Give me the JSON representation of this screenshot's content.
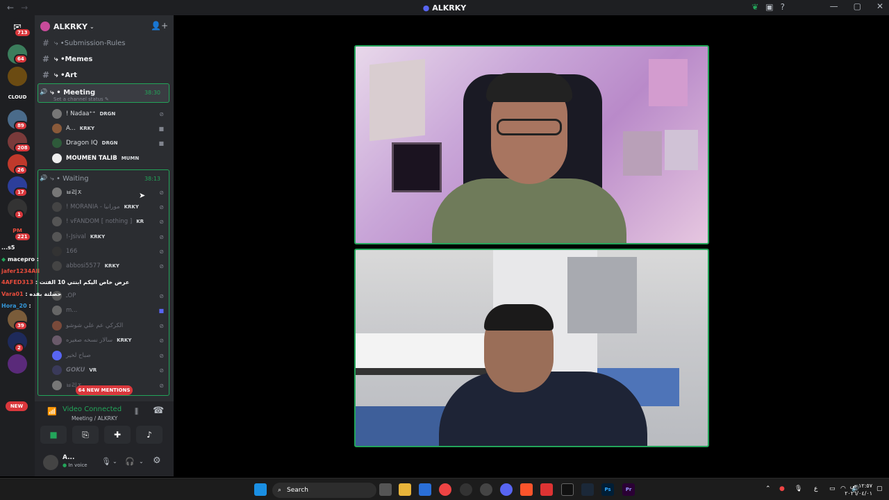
{
  "window": {
    "title": "ALKRKY",
    "back": "←",
    "forward": "→"
  },
  "guilds": {
    "home_badge": "713",
    "badges": [
      "64",
      "89",
      "208",
      "26",
      "17",
      "1",
      "221",
      "39",
      "2"
    ],
    "icon_labels": [
      "CLOUD",
      "PM",
      "NEW"
    ],
    "new_label": "NEW"
  },
  "server": {
    "name": "ALKRKY"
  },
  "channels": [
    {
      "name": "Submission-Rules"
    },
    {
      "name": "Memes"
    },
    {
      "name": "Art"
    }
  ],
  "meeting": {
    "name": "Meeting",
    "timer": "38:30",
    "status_hint": "Set a channel status",
    "users": [
      {
        "name": "! Nadaa⁺⁺",
        "tag": "DRGN"
      },
      {
        "name": "A...",
        "tag": "KRKY"
      },
      {
        "name": "Dragon IQ",
        "tag": "DRGN"
      },
      {
        "name": "MOUMEN TALIB",
        "tag": "MUMN"
      }
    ]
  },
  "waiting": {
    "name": "Waiting",
    "timer": "38:13",
    "users": [
      {
        "name": "ㅂ리ㅈ",
        "tag": ""
      },
      {
        "name": "! MORANIA - مورانيا",
        "tag": "KRKY"
      },
      {
        "name": "! vFANDOM [ nothing ]",
        "tag": "KR"
      },
      {
        "name": "!-Jsival",
        "tag": "KRKY"
      },
      {
        "name": "166",
        "tag": ""
      },
      {
        "name": "abbosi5577",
        "tag": "KRKY"
      },
      {
        "name": "ـOP",
        "tag": ""
      },
      {
        "name": "m...",
        "tag": ""
      },
      {
        "name": "الكركي عم علي شوشو",
        "tag": ""
      },
      {
        "name": "سالار نسخه صغيره",
        "tag": "KRKY"
      },
      {
        "name": "صباح لخير",
        "tag": ""
      },
      {
        "name": "GOKU",
        "tag": "VR"
      },
      {
        "name": "ㅂ리ㅈ",
        "tag": ""
      }
    ]
  },
  "mentions": "64 NEW MENTIONS",
  "voice": {
    "status": "Video Connected",
    "location": "Meeting / ALKRKY"
  },
  "user": {
    "name": "A...",
    "status": "In voice"
  },
  "chat_overlay": [
    {
      "name": "...s5",
      "text": ""
    },
    {
      "name": "macepro",
      "text": ""
    },
    {
      "name": "jafer1234Ali",
      "text": ""
    },
    {
      "name": "4AFED313",
      "text": "عرض خاص اليكم ابنتي 10 الفتت"
    },
    {
      "name": "Vara01",
      "text": "حصلتة بقده"
    },
    {
      "name": "Hora_20",
      "text": ""
    }
  ],
  "taskbar": {
    "search": "Search",
    "clock_time": "١٢:٥٧ ص",
    "clock_date": "٢٠٢٦/٠٤/٠١",
    "lang": "ع"
  },
  "colors": {
    "green": "#23a55a",
    "red": "#da373c",
    "blurple": "#5865f2"
  }
}
